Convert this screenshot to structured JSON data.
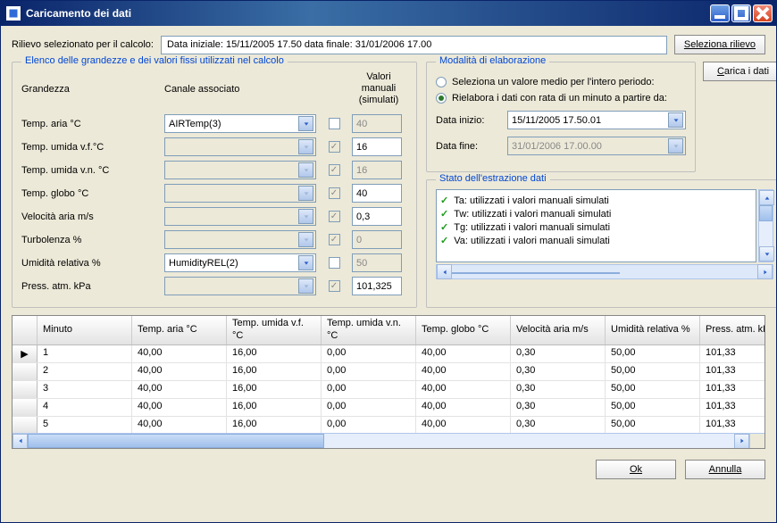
{
  "titlebar": {
    "title": "Caricamento dei dati"
  },
  "toprow": {
    "label": "Rilievo selezionato per il calcolo:",
    "value": "Data iniziale: 15/11/2005 17.50  data finale: 31/01/2006 17.00",
    "select_btn": "Seleziona rilievo"
  },
  "load_btn": "Carica i dati",
  "grandezze": {
    "legend": "Elenco delle grandezze e dei valori fissi utilizzati nel calcolo",
    "col_grandezza": "Grandezza",
    "col_canale": "Canale associato",
    "col_manual": "Valori manuali (simulati)",
    "rows": [
      {
        "label": "Temp. aria °C",
        "channel": "AIRTemp(3)",
        "channel_enabled": true,
        "chk": false,
        "chk_enabled": true,
        "val": "40",
        "val_enabled": false
      },
      {
        "label": "Temp. umida v.f.°C",
        "channel": "",
        "channel_enabled": false,
        "chk": true,
        "chk_enabled": false,
        "val": "16",
        "val_enabled": true
      },
      {
        "label": "Temp. umida v.n. °C",
        "channel": "",
        "channel_enabled": false,
        "chk": true,
        "chk_enabled": false,
        "val": "16",
        "val_enabled": false
      },
      {
        "label": "Temp. globo °C",
        "channel": "",
        "channel_enabled": false,
        "chk": true,
        "chk_enabled": false,
        "val": "40",
        "val_enabled": true
      },
      {
        "label": "Velocità aria m/s",
        "channel": "",
        "channel_enabled": false,
        "chk": true,
        "chk_enabled": false,
        "val": "0,3",
        "val_enabled": true
      },
      {
        "label": "Turbolenza %",
        "channel": "",
        "channel_enabled": false,
        "chk": true,
        "chk_enabled": false,
        "val": "0",
        "val_enabled": false
      },
      {
        "label": "Umidità relativa %",
        "channel": "HumidityREL(2)",
        "channel_enabled": true,
        "chk": false,
        "chk_enabled": true,
        "val": "50",
        "val_enabled": false
      },
      {
        "label": "Press. atm. kPa",
        "channel": "",
        "channel_enabled": false,
        "chk": true,
        "chk_enabled": false,
        "val": "101,325",
        "val_enabled": true
      }
    ]
  },
  "mode": {
    "legend": "Modalità di elaborazione",
    "opt1": "Seleziona un valore medio per l'intero periodo:",
    "opt2": "Rielabora i dati con rata di un minuto a partire da:",
    "selected": 2,
    "data_inizio_lbl": "Data inizio:",
    "data_inizio_val": "15/11/2005 17.50.01",
    "data_fine_lbl": "Data fine:",
    "data_fine_val": "31/01/2006 17.00.00"
  },
  "status": {
    "legend": "Stato dell'estrazione dati",
    "items": [
      "Ta: utilizzati i valori manuali simulati",
      "Tw: utilizzati i valori manuali simulati",
      "Tg: utilizzati i valori manuali simulati",
      "Va: utilizzati i valori manuali simulati"
    ]
  },
  "datagrid": {
    "columns": [
      "Minuto",
      "Temp. aria °C",
      "Temp. umida v.f. °C",
      "Temp. umida v.n. °C",
      "Temp. globo °C",
      "Velocità aria m/s",
      "Umidità relativa %",
      "Press. atm. kPa"
    ],
    "rows": [
      [
        "1",
        "40,00",
        "16,00",
        "0,00",
        "40,00",
        "0,30",
        "50,00",
        "101,33"
      ],
      [
        "2",
        "40,00",
        "16,00",
        "0,00",
        "40,00",
        "0,30",
        "50,00",
        "101,33"
      ],
      [
        "3",
        "40,00",
        "16,00",
        "0,00",
        "40,00",
        "0,30",
        "50,00",
        "101,33"
      ],
      [
        "4",
        "40,00",
        "16,00",
        "0,00",
        "40,00",
        "0,30",
        "50,00",
        "101,33"
      ],
      [
        "5",
        "40,00",
        "16,00",
        "0,00",
        "40,00",
        "0,30",
        "50,00",
        "101,33"
      ]
    ]
  },
  "footer": {
    "ok": "Ok",
    "cancel": "Annulla"
  }
}
